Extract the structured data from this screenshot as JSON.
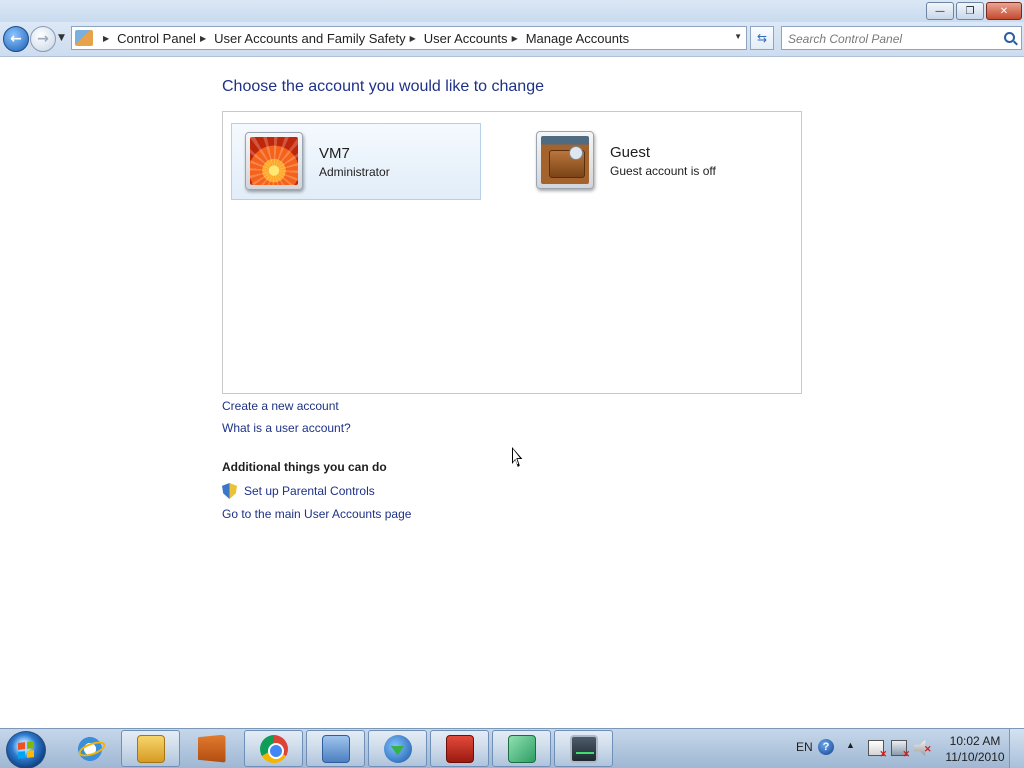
{
  "window": {
    "minimize_glyph": "—",
    "maximize_glyph": "❐",
    "close_glyph": "✕"
  },
  "nav": {
    "back_glyph": "←",
    "forward_glyph": "→",
    "recent_glyph": "▼",
    "breadcrumbs": [
      "Control Panel",
      "User Accounts and Family Safety",
      "User Accounts",
      "Manage Accounts"
    ],
    "breadcrumb_sep": "▶",
    "address_dropdown_glyph": "▼",
    "refresh_glyph": "⇆",
    "search_placeholder": "Search Control Panel",
    "address_icon": "users-folder-icon"
  },
  "content": {
    "heading": "Choose the account you would like to change",
    "accounts": [
      {
        "name": "VM7",
        "type": "Administrator",
        "avatar": "orange-flower-avatar",
        "selected": true
      },
      {
        "name": "Guest",
        "type": "Guest account is off",
        "avatar": "briefcase-avatar",
        "selected": false
      }
    ],
    "links": {
      "create": "Create a new account",
      "what_is": "What is a user account?"
    },
    "additional_heading": "Additional things you can do",
    "additional_links": {
      "parental": "Set up Parental Controls",
      "main_accounts": "Go to the main User Accounts page"
    }
  },
  "taskbar": {
    "pinned": [
      {
        "name": "internet-explorer",
        "active": false
      },
      {
        "name": "windows-explorer",
        "active": true
      },
      {
        "name": "media-player",
        "active": false
      },
      {
        "name": "google-chrome",
        "active": true
      },
      {
        "name": "control-panel",
        "active": true
      },
      {
        "name": "internet-download-manager",
        "active": true
      },
      {
        "name": "toolbox",
        "active": true
      },
      {
        "name": "window-app",
        "active": true
      },
      {
        "name": "monitor-app",
        "active": true
      }
    ],
    "tray": {
      "language": "EN",
      "help_glyph": "?",
      "show_hidden_glyph": "▲",
      "time": "10:02 AM",
      "date": "11/10/2010"
    }
  },
  "colors": {
    "link": "#1e3287",
    "heading": "#1e3287",
    "selected_tile_bg": "#e2edf8",
    "taskbar": "#9fb7d3"
  }
}
